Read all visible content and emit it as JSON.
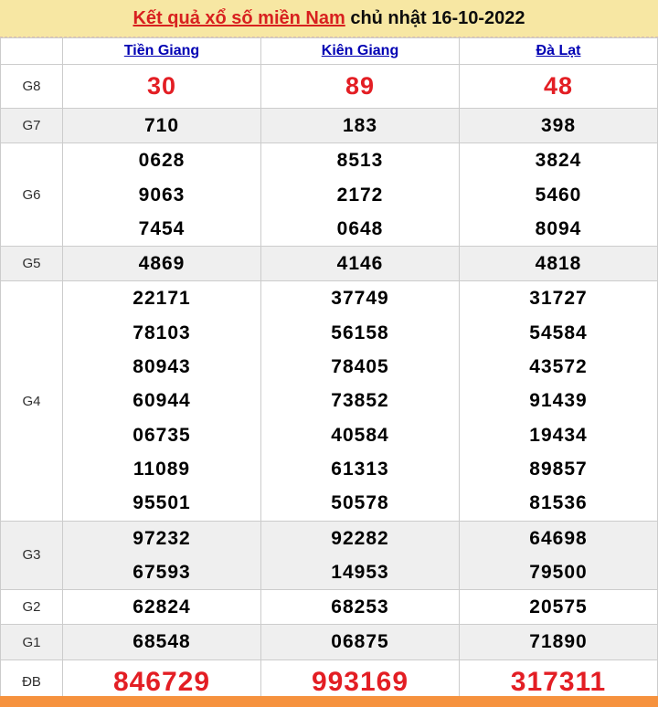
{
  "header": {
    "link_text": "Kết quả xổ số miền Nam",
    "date_text": " chủ nhật 16-10-2022"
  },
  "columns": [
    "Tiền Giang",
    "Kiên Giang",
    "Đà Lạt"
  ],
  "rows": [
    {
      "label": "G8",
      "style": "red-medium",
      "shade": "white",
      "cells": [
        [
          "30"
        ],
        [
          "89"
        ],
        [
          "48"
        ]
      ]
    },
    {
      "label": "G7",
      "style": "normal",
      "shade": "gray",
      "cells": [
        [
          "710"
        ],
        [
          "183"
        ],
        [
          "398"
        ]
      ]
    },
    {
      "label": "G6",
      "style": "normal",
      "shade": "white",
      "cells": [
        [
          "0628",
          "9063",
          "7454"
        ],
        [
          "8513",
          "2172",
          "0648"
        ],
        [
          "3824",
          "5460",
          "8094"
        ]
      ]
    },
    {
      "label": "G5",
      "style": "normal",
      "shade": "gray",
      "cells": [
        [
          "4869"
        ],
        [
          "4146"
        ],
        [
          "4818"
        ]
      ]
    },
    {
      "label": "G4",
      "style": "normal",
      "shade": "white",
      "cells": [
        [
          "22171",
          "78103",
          "80943",
          "60944",
          "06735",
          "11089",
          "95501"
        ],
        [
          "37749",
          "56158",
          "78405",
          "73852",
          "40584",
          "61313",
          "50578"
        ],
        [
          "31727",
          "54584",
          "43572",
          "91439",
          "19434",
          "89857",
          "81536"
        ]
      ]
    },
    {
      "label": "G3",
      "style": "normal",
      "shade": "gray",
      "cells": [
        [
          "97232",
          "67593"
        ],
        [
          "92282",
          "14953"
        ],
        [
          "64698",
          "79500"
        ]
      ]
    },
    {
      "label": "G2",
      "style": "normal",
      "shade": "white",
      "cells": [
        [
          "62824"
        ],
        [
          "68253"
        ],
        [
          "20575"
        ]
      ]
    },
    {
      "label": "G1",
      "style": "normal",
      "shade": "gray",
      "cells": [
        [
          "68548"
        ],
        [
          "06875"
        ],
        [
          "71890"
        ]
      ]
    },
    {
      "label": "ĐB",
      "style": "red-large",
      "shade": "white",
      "cells": [
        [
          "846729"
        ],
        [
          "993169"
        ],
        [
          "317311"
        ]
      ]
    }
  ],
  "colors": {
    "title_bar_bg": "#f7e7a3",
    "title_link_red": "#d8201f",
    "number_red": "#e31e24",
    "province_link_blue": "#0000b3",
    "row_shade_gray": "#efefef",
    "table_border": "#cccccc",
    "bottom_bar_orange": "#f6923e"
  }
}
